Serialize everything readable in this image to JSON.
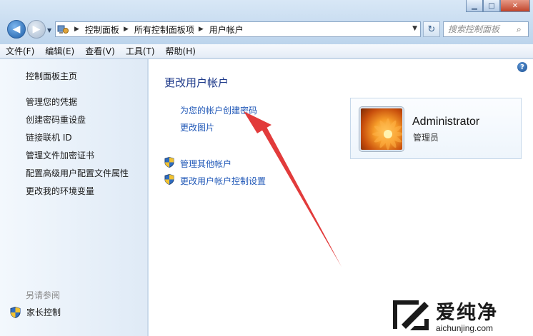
{
  "window_controls": {
    "minimize": "▁",
    "maximize": "□",
    "close": "✕"
  },
  "address": {
    "crumbs": [
      "控制面板",
      "所有控制面板项",
      "用户帐户"
    ],
    "refresh_glyph": "↻"
  },
  "search": {
    "placeholder": "搜索控制面板"
  },
  "menu": [
    "文件(F)",
    "编辑(E)",
    "查看(V)",
    "工具(T)",
    "帮助(H)"
  ],
  "sidebar": {
    "home": "控制面板主页",
    "items": [
      "管理您的凭据",
      "创建密码重设盘",
      "链接联机 ID",
      "管理文件加密证书",
      "配置高级用户配置文件属性",
      "更改我的环境变量"
    ],
    "see_also": "另请参阅",
    "parental_controls": "家长控制"
  },
  "main": {
    "title": "更改用户帐户",
    "create_password": "为您的帐户创建密码",
    "change_picture": "更改图片",
    "manage_accounts": "管理其他帐户",
    "uac_settings": "更改用户帐户控制设置"
  },
  "user": {
    "name": "Administrator",
    "role": "管理员"
  },
  "watermark": {
    "brand": "爱纯净",
    "url": "aichunjing.com"
  },
  "colors": {
    "link": "#1f57b7",
    "title": "#1e3a8a",
    "arrow": "#e23b3b"
  }
}
